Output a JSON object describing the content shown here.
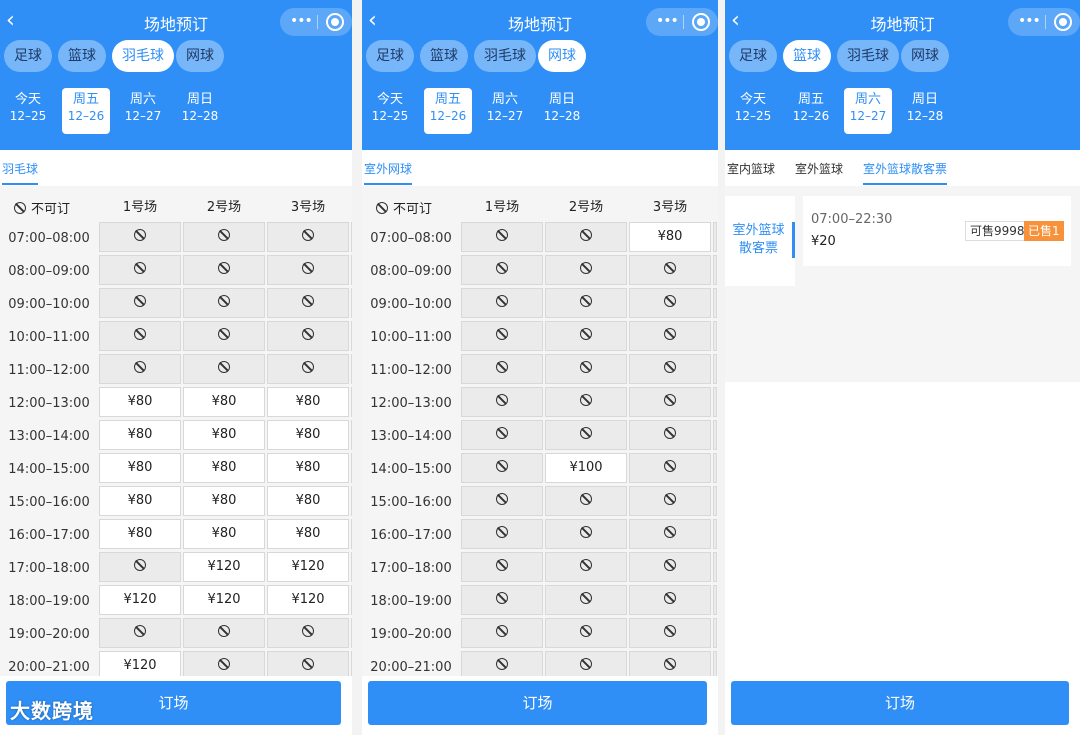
{
  "title": "场地预订",
  "back_icon": "chevron-left-icon",
  "more_icon": "more-dots-icon",
  "close_icon": "target-icon",
  "book_label": "订场",
  "watermark": "大数跨境",
  "colors": {
    "primary": "#2f8ff6",
    "orange": "#f7913a"
  },
  "legend": "不可订",
  "courts": [
    "1号场",
    "2号场",
    "3号场"
  ],
  "times": [
    "07:00–08:00",
    "08:00–09:00",
    "09:00–10:00",
    "10:00–11:00",
    "11:00–12:00",
    "12:00–13:00",
    "13:00–14:00",
    "14:00–15:00",
    "15:00–16:00",
    "16:00–17:00",
    "17:00–18:00",
    "18:00–19:00",
    "19:00–20:00",
    "20:00–21:00"
  ],
  "panels": [
    {
      "sports": [
        "足球",
        "篮球",
        "羽毛球",
        "网球"
      ],
      "active_sport": 2,
      "dates": [
        {
          "day": "今天",
          "date": "12–25"
        },
        {
          "day": "周五",
          "date": "12–26"
        },
        {
          "day": "周六",
          "date": "12–27"
        },
        {
          "day": "周日",
          "date": "12–28"
        }
      ],
      "active_date": 1,
      "subtab": "羽毛球",
      "grid": [
        [
          "x",
          "x",
          "x"
        ],
        [
          "x",
          "x",
          "x"
        ],
        [
          "x",
          "x",
          "x"
        ],
        [
          "x",
          "x",
          "x"
        ],
        [
          "x",
          "x",
          "x"
        ],
        [
          "¥80",
          "¥80",
          "¥80"
        ],
        [
          "¥80",
          "¥80",
          "¥80"
        ],
        [
          "¥80",
          "¥80",
          "¥80"
        ],
        [
          "¥80",
          "¥80",
          "¥80"
        ],
        [
          "¥80",
          "¥80",
          "¥80"
        ],
        [
          "x",
          "¥120",
          "¥120"
        ],
        [
          "¥120",
          "¥120",
          "¥120"
        ],
        [
          "x",
          "x",
          "x"
        ],
        [
          "¥120",
          "x",
          "x"
        ]
      ]
    },
    {
      "sports": [
        "足球",
        "篮球",
        "羽毛球",
        "网球"
      ],
      "active_sport": 3,
      "dates": [
        {
          "day": "今天",
          "date": "12–25"
        },
        {
          "day": "周五",
          "date": "12–26"
        },
        {
          "day": "周六",
          "date": "12–27"
        },
        {
          "day": "周日",
          "date": "12–28"
        }
      ],
      "active_date": 1,
      "subtab": "室外网球",
      "grid": [
        [
          "x",
          "x",
          "¥80"
        ],
        [
          "x",
          "x",
          "x"
        ],
        [
          "x",
          "x",
          "x"
        ],
        [
          "x",
          "x",
          "x"
        ],
        [
          "x",
          "x",
          "x"
        ],
        [
          "x",
          "x",
          "x"
        ],
        [
          "x",
          "x",
          "x"
        ],
        [
          "x",
          "¥100",
          "x"
        ],
        [
          "x",
          "x",
          "x"
        ],
        [
          "x",
          "x",
          "x"
        ],
        [
          "x",
          "x",
          "x"
        ],
        [
          "x",
          "x",
          "x"
        ],
        [
          "x",
          "x",
          "x"
        ],
        [
          "x",
          "x",
          "x"
        ]
      ]
    },
    {
      "sports": [
        "足球",
        "篮球",
        "羽毛球",
        "网球"
      ],
      "active_sport": 1,
      "dates": [
        {
          "day": "今天",
          "date": "12–25"
        },
        {
          "day": "周五",
          "date": "12–26"
        },
        {
          "day": "周六",
          "date": "12–27"
        },
        {
          "day": "周日",
          "date": "12–28"
        }
      ],
      "active_date": 2,
      "subtabs": [
        "室内篮球",
        "室外篮球",
        "室外篮球散客票"
      ],
      "active_subtab": 2,
      "category": "室外篮球散客票",
      "ticket": {
        "time": "07:00–22:30",
        "price": "¥20",
        "available": "可售9998",
        "sold": "已售1"
      }
    }
  ]
}
